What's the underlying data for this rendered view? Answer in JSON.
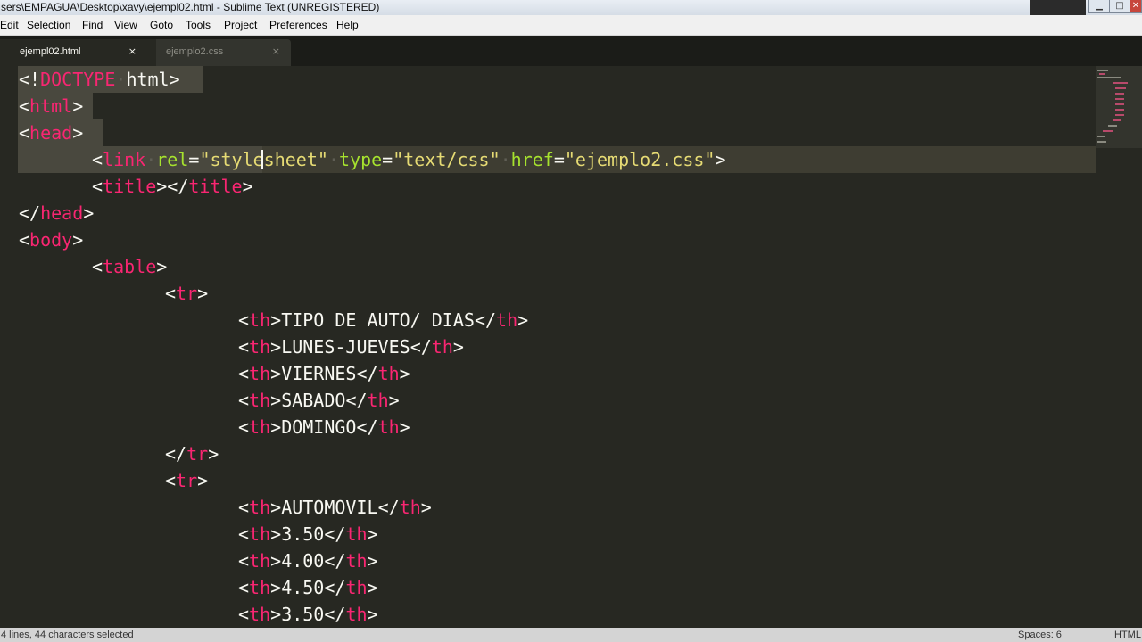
{
  "window": {
    "title": "sers\\EMPAGUA\\Desktop\\xavy\\ejempl02.html - Sublime Text (UNREGISTERED)",
    "controls": {
      "minimize": "▁",
      "maximize": "□",
      "close": "✕"
    }
  },
  "menu": [
    "Edit",
    "Selection",
    "Find",
    "View",
    "Goto",
    "Tools",
    "Project",
    "Preferences",
    "Help"
  ],
  "tabs": [
    {
      "label": "ejempl02.html",
      "close": "×"
    },
    {
      "label": "ejemplo2.css",
      "close": "×"
    }
  ],
  "code": {
    "l1": {
      "a": "<",
      "b": "!",
      "c": "DOCTYPE",
      "d": "·",
      "e": "html",
      "f": ">"
    },
    "l2": {
      "a": "<",
      "b": "html",
      "c": ">"
    },
    "l3": {
      "a": "<",
      "b": "head",
      "c": ">"
    },
    "l4": {
      "a": "<",
      "b": "link",
      "c": "·",
      "d": "rel",
      "e": "=",
      "f": "\"stylesheet\"",
      "g": "·",
      "h": "type",
      "i": "=",
      "j": "\"text/css\"",
      "k": "·",
      "m": "href",
      "n": "=",
      "o": "\"ejemplo2.css\"",
      "p": ">"
    },
    "l5": {
      "a": "<",
      "b": "title",
      "c": "></",
      "d": "title",
      "e": ">"
    },
    "l6": {
      "a": "</",
      "b": "head",
      "c": ">"
    },
    "l7": {
      "a": "<",
      "b": "body",
      "c": ">"
    },
    "l8": {
      "a": "<",
      "b": "table",
      "c": ">"
    },
    "l9": {
      "a": "<",
      "b": "tr",
      "c": ">"
    },
    "th_tag": "th",
    "tr_tag": "tr",
    "header_cells": [
      "TIPO DE AUTO/ DIAS",
      "LUNES-JUEVES",
      "VIERNES",
      "SABADO",
      "DOMINGO"
    ],
    "row_cells": [
      "AUTOMOVIL",
      "3.50",
      "4.00",
      "4.50",
      "3.50"
    ],
    "open_lt": "<",
    "close_lt": "</",
    "gt": ">"
  },
  "status": {
    "left": "4 lines, 44 characters selected",
    "spaces": "Spaces: 6",
    "syntax": "HTML"
  },
  "colors": {
    "background": "#272822",
    "tag": "#f92672",
    "attribute": "#a6e22e",
    "string": "#e6db74",
    "text": "#f8f8f2"
  }
}
